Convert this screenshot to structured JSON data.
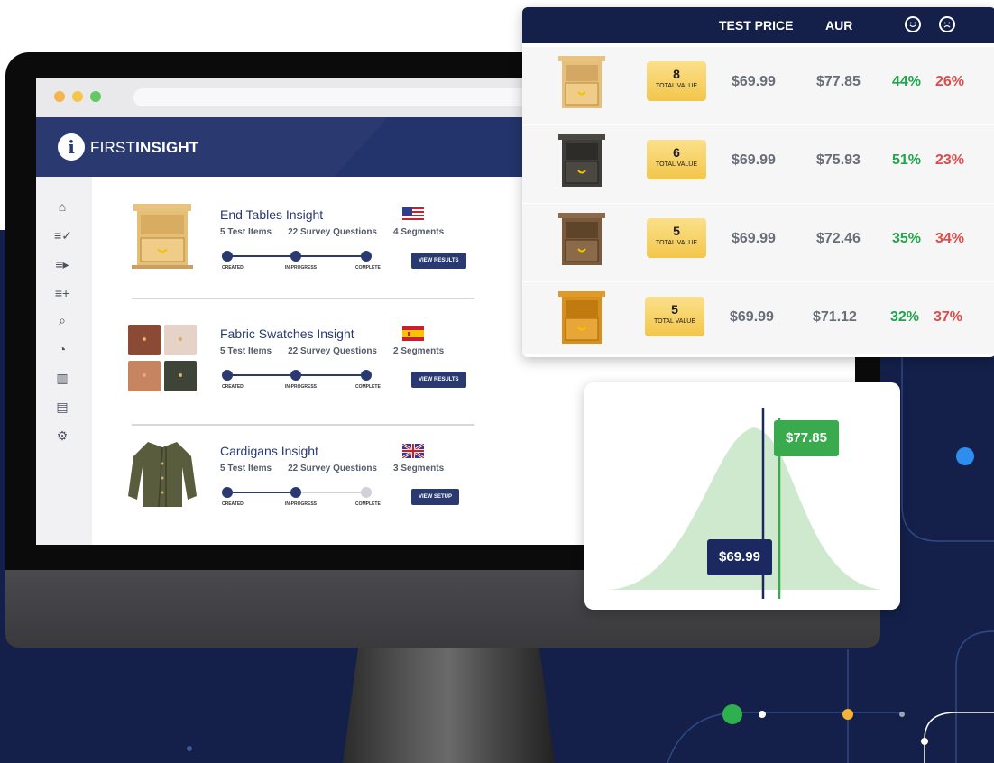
{
  "app": {
    "logo_first": "FIRST",
    "logo_second": "INSIGHT",
    "logo_mark": "i"
  },
  "sidebar": {
    "items": [
      {
        "icon": "home-icon",
        "glyph": "⌂"
      },
      {
        "icon": "list-check-icon",
        "glyph": "≡✓"
      },
      {
        "icon": "list-play-icon",
        "glyph": "≡▸"
      },
      {
        "icon": "list-add-icon",
        "glyph": "≡+"
      },
      {
        "icon": "search-icon",
        "glyph": "⌕"
      },
      {
        "icon": "gauge-icon",
        "glyph": "◔"
      },
      {
        "icon": "bar-chart-icon",
        "glyph": "▥"
      },
      {
        "icon": "table-icon",
        "glyph": "▤"
      },
      {
        "icon": "gear-icon",
        "glyph": "⚙"
      }
    ]
  },
  "insights": [
    {
      "title": "End Tables Insight",
      "test_items": "5 Test Items",
      "survey_questions": "22 Survey Questions",
      "segments": "4 Segments",
      "flag": "us-flag",
      "steps": [
        "CREATED",
        "IN-PROGRESS",
        "COMPLETE"
      ],
      "completed_steps": 3,
      "button": "VIEW RESULTS"
    },
    {
      "title": "Fabric Swatches Insight",
      "test_items": "5 Test Items",
      "survey_questions": "22 Survey Questions",
      "segments": "2 Segments",
      "flag": "spain-flag",
      "steps": [
        "CREATED",
        "IN-PROGRESS",
        "COMPLETE"
      ],
      "completed_steps": 3,
      "button": "VIEW RESULTS"
    },
    {
      "title": "Cardigans Insight",
      "test_items": "5 Test Items",
      "survey_questions": "22 Survey Questions",
      "segments": "3 Segments",
      "flag": "uk-flag",
      "steps": [
        "CREATED",
        "IN-PROGRESS",
        "COMPLETE"
      ],
      "completed_steps": 2,
      "button": "VIEW SETUP"
    }
  ],
  "price_table": {
    "headers": {
      "test_price": "TEST PRICE",
      "aur": "AUR",
      "positive": "happy-face-icon",
      "negative": "sad-face-icon"
    },
    "total_value_label": "TOTAL VALUE",
    "rows": [
      {
        "total_value": "8",
        "test_price": "$69.99",
        "aur": "$77.85",
        "positive": "44%",
        "negative": "26%",
        "item_color": "#e6c07a"
      },
      {
        "total_value": "6",
        "test_price": "$69.99",
        "aur": "$75.93",
        "positive": "51%",
        "negative": "23%",
        "item_color": "#3f3d37"
      },
      {
        "total_value": "5",
        "test_price": "$69.99",
        "aur": "$72.46",
        "positive": "35%",
        "negative": "34%",
        "item_color": "#7a5a3a"
      },
      {
        "total_value": "5",
        "test_price": "$69.99",
        "aur": "$71.12",
        "positive": "32%",
        "negative": "37%",
        "item_color": "#d8901c"
      }
    ]
  },
  "distribution": {
    "aur_label": "$77.85",
    "test_price_label": "$69.99"
  },
  "colors": {
    "navy": "#14204a",
    "brand": "#2a3a70",
    "positive": "#1fa54a",
    "negative": "#e04a4a",
    "gold": "#f3c64a",
    "curve": "#cfe9cf"
  }
}
